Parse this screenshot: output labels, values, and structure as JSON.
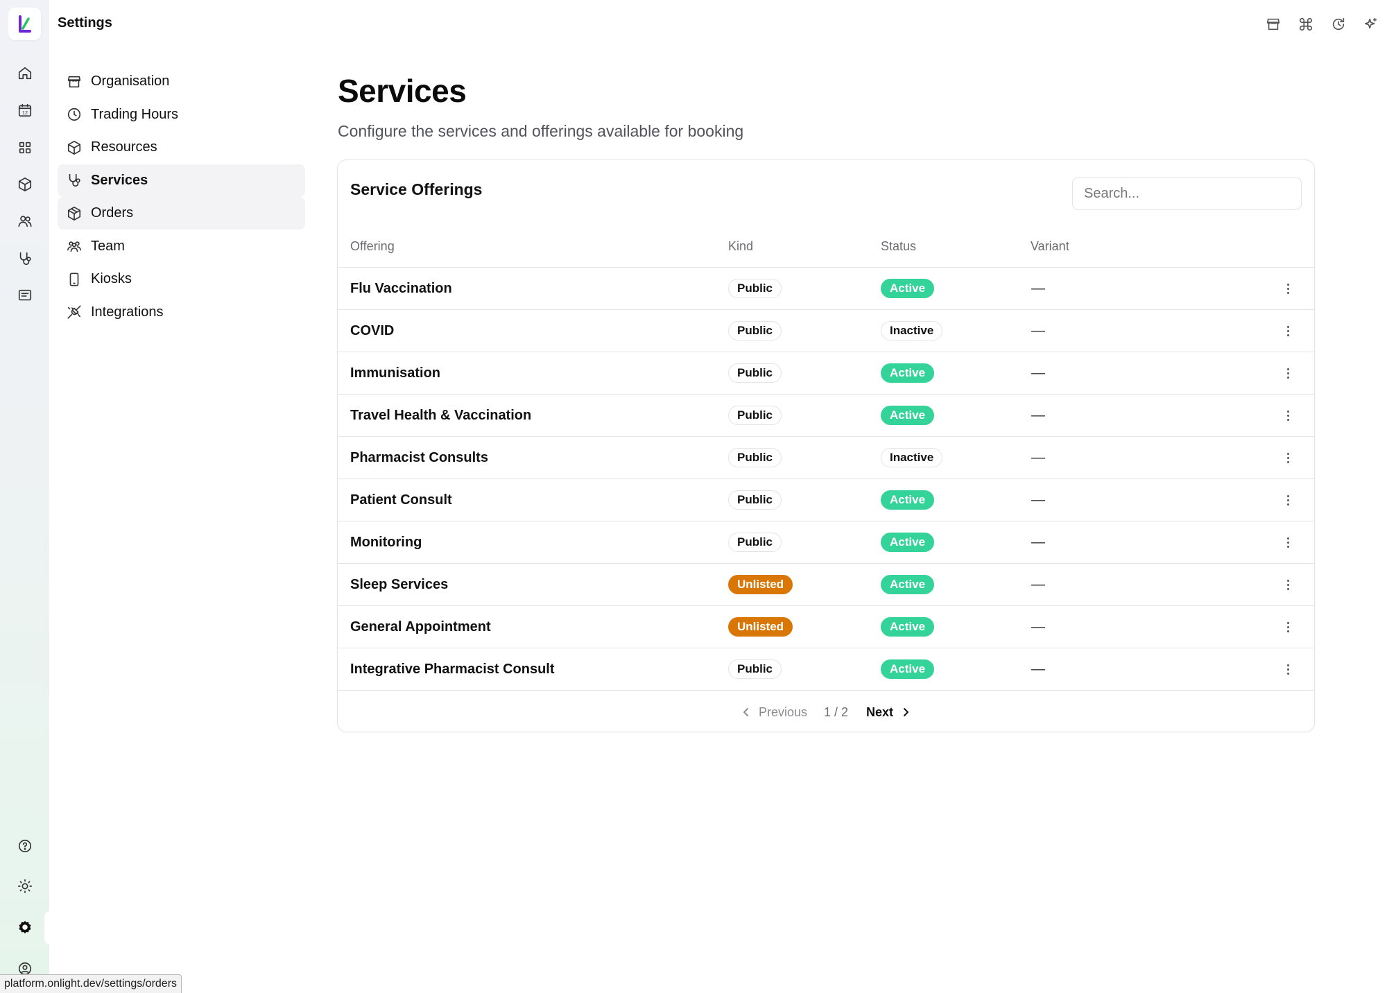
{
  "header": {
    "title": "Settings",
    "top_icons": [
      "store-icon",
      "command-icon",
      "history-icon",
      "sparkles-icon"
    ]
  },
  "rail": {
    "icons": [
      "home-icon",
      "calendar-icon",
      "grid-icon",
      "box-icon",
      "users-icon",
      "stethoscope-icon",
      "message-icon",
      "help-icon",
      "sun-icon",
      "settings-icon",
      "account-icon"
    ],
    "calendar_day": "12",
    "active": "settings-icon"
  },
  "settings_nav": {
    "items": [
      {
        "label": "Organisation",
        "icon": "store-icon"
      },
      {
        "label": "Trading Hours",
        "icon": "clock-icon"
      },
      {
        "label": "Resources",
        "icon": "box-icon"
      },
      {
        "label": "Services",
        "icon": "stethoscope-icon",
        "active": true
      },
      {
        "label": "Orders",
        "icon": "package-icon",
        "hover": true
      },
      {
        "label": "Team",
        "icon": "users-icon"
      },
      {
        "label": "Kiosks",
        "icon": "tablet-icon"
      },
      {
        "label": "Integrations",
        "icon": "plug-icon"
      }
    ]
  },
  "main": {
    "title": "Services",
    "subtitle": "Configure the services and offerings available for booking",
    "card": {
      "title": "Service Offerings",
      "search_placeholder": "Search..."
    },
    "table": {
      "headers": {
        "offering": "Offering",
        "kind": "Kind",
        "status": "Status",
        "variant": "Variant"
      },
      "rows": [
        {
          "offering": "Flu Vaccination",
          "kind": "Public",
          "status": "Active",
          "variant": "—"
        },
        {
          "offering": "COVID",
          "kind": "Public",
          "status": "Inactive",
          "variant": "—"
        },
        {
          "offering": "Immunisation",
          "kind": "Public",
          "status": "Active",
          "variant": "—"
        },
        {
          "offering": "Travel Health & Vaccination",
          "kind": "Public",
          "status": "Active",
          "variant": "—"
        },
        {
          "offering": "Pharmacist Consults",
          "kind": "Public",
          "status": "Inactive",
          "variant": "—"
        },
        {
          "offering": "Patient Consult",
          "kind": "Public",
          "status": "Active",
          "variant": "—"
        },
        {
          "offering": "Monitoring",
          "kind": "Public",
          "status": "Active",
          "variant": "—"
        },
        {
          "offering": "Sleep Services",
          "kind": "Unlisted",
          "status": "Active",
          "variant": "—"
        },
        {
          "offering": "General Appointment",
          "kind": "Unlisted",
          "status": "Active",
          "variant": "—"
        },
        {
          "offering": "Integrative Pharmacist Consult",
          "kind": "Public",
          "status": "Active",
          "variant": "—"
        }
      ]
    },
    "pagination": {
      "previous_label": "Previous",
      "page_count": "1 / 2",
      "next_label": "Next"
    }
  },
  "status_bar": {
    "url": "platform.onlight.dev/settings/orders"
  },
  "colors": {
    "unlisted": "#d97706",
    "active": "#34d399",
    "brand": "#6d28d9",
    "brand_accent": "#22c55e"
  }
}
